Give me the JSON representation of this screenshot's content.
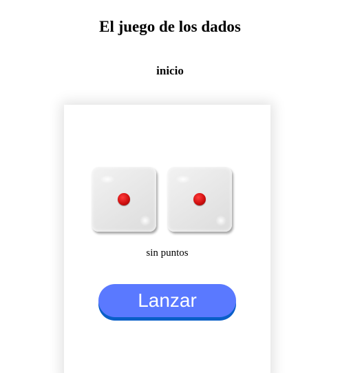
{
  "header": {
    "title": "El juego de los dados",
    "status": "inicio"
  },
  "game": {
    "dice": [
      {
        "value": 1
      },
      {
        "value": 1
      }
    ],
    "points_text": "sin puntos",
    "roll_button_label": "Lanzar"
  },
  "colors": {
    "button_bg": "#5a79ff",
    "button_shadow": "#0a5fc8",
    "pip": "#d01010"
  }
}
